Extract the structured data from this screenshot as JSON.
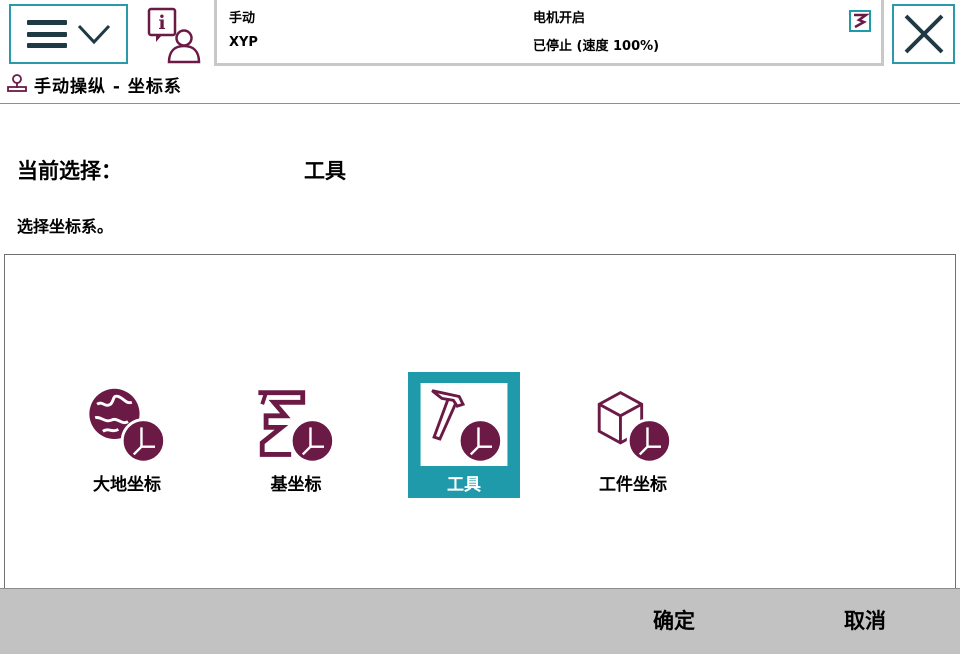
{
  "header": {
    "menu_icon": "hamburger-menu-icon",
    "info_icon": "info-user-icon",
    "status": {
      "mode": "手动",
      "unit": "XYP",
      "motor": "电机开启",
      "state": "已停止 (速度 100%)"
    },
    "close_icon": "close-icon"
  },
  "title": {
    "text": "手动操纵 - 坐标系",
    "icon": "jog-icon"
  },
  "selection": {
    "current_label": "当前选择：",
    "current_value": "工具",
    "instruction": "选择坐标系。"
  },
  "coordinate_systems": [
    {
      "label": "大地坐标",
      "icon": "world-frame-icon",
      "selected": false
    },
    {
      "label": "基坐标",
      "icon": "base-frame-icon",
      "selected": false
    },
    {
      "label": "工具",
      "icon": "tool-frame-icon",
      "selected": true
    },
    {
      "label": "工件坐标",
      "icon": "workobject-frame-icon",
      "selected": false
    }
  ],
  "footer": {
    "ok_label": "确定",
    "cancel_label": "取消"
  },
  "colors": {
    "accent": "#1f9aaa",
    "icon": "#6b1a45",
    "footer_bg": "#c2c2c2"
  }
}
